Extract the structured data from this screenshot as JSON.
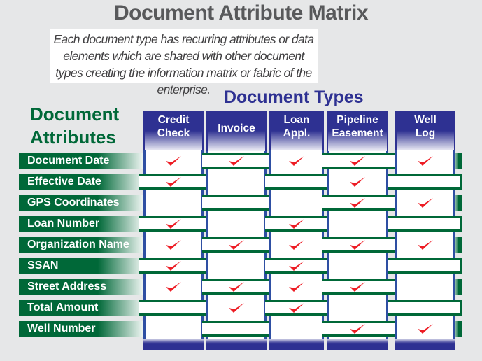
{
  "title": "Document Attribute Matrix",
  "description": "Each document type has recurring attributes or data elements which are shared with other document types creating the information matrix or fabric of the enterprise.",
  "document_types_title": "Document Types",
  "document_attributes_title": "Document Attributes",
  "colors": {
    "attribute_green": "#006838",
    "type_blue": "#2e3192",
    "check_red": "#ed1c24",
    "title_gray": "#58595b"
  },
  "columns": [
    {
      "label": "Credit Check",
      "lines": [
        "Credit",
        "Check"
      ]
    },
    {
      "label": "Invoice",
      "lines": [
        "Invoice"
      ]
    },
    {
      "label": "Loan Appl.",
      "lines": [
        "Loan",
        "Appl."
      ]
    },
    {
      "label": "Pipeline Easement",
      "lines": [
        "Pipeline",
        "Easement"
      ]
    },
    {
      "label": "Well Log",
      "lines": [
        "Well",
        "Log"
      ]
    }
  ],
  "rows": [
    {
      "label": "Document Date",
      "checks": [
        true,
        true,
        true,
        true,
        true
      ]
    },
    {
      "label": "Effective Date",
      "checks": [
        true,
        false,
        false,
        true,
        false
      ]
    },
    {
      "label": "GPS Coordinates",
      "checks": [
        false,
        false,
        false,
        true,
        true
      ]
    },
    {
      "label": "Loan Number",
      "checks": [
        true,
        false,
        true,
        false,
        false
      ]
    },
    {
      "label": "Organization Name",
      "checks": [
        true,
        true,
        true,
        true,
        true
      ]
    },
    {
      "label": "SSAN",
      "checks": [
        true,
        false,
        true,
        false,
        false
      ]
    },
    {
      "label": "Street Address",
      "checks": [
        true,
        true,
        true,
        true,
        false
      ]
    },
    {
      "label": "Total Amount",
      "checks": [
        false,
        true,
        true,
        false,
        false
      ]
    },
    {
      "label": "Well Number",
      "checks": [
        false,
        false,
        false,
        true,
        true
      ]
    }
  ],
  "check_icon": "red-checkmark"
}
